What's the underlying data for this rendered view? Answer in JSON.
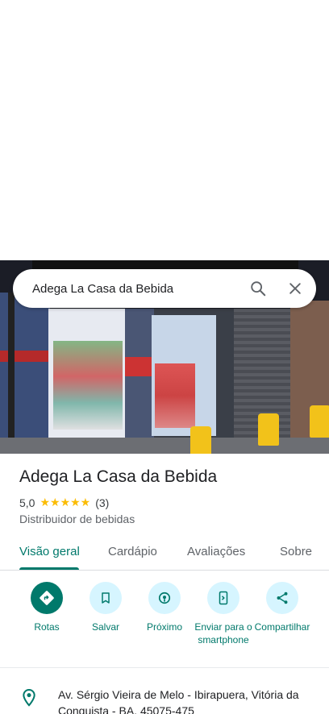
{
  "search": {
    "query": "Adega La Casa da Bebida"
  },
  "place": {
    "name": "Adega La Casa da Bebida",
    "rating": "5,0",
    "stars": "★★★★★",
    "reviews_count": "(3)",
    "category": "Distribuidor de bebidas",
    "address": "Av. Sérgio Vieira de Melo - Ibirapuera, Vitória da Conquista - BA, 45075-475"
  },
  "tabs": [
    {
      "label": "Visão geral",
      "active": true
    },
    {
      "label": "Cardápio"
    },
    {
      "label": "Avaliações"
    },
    {
      "label": "Sobre"
    }
  ],
  "actions": [
    {
      "label": "Rotas",
      "icon": "directions-icon"
    },
    {
      "label": "Salvar",
      "icon": "bookmark-icon"
    },
    {
      "label": "Próximo",
      "icon": "nearby-icon"
    },
    {
      "label": "Enviar para o smartphone",
      "icon": "send-to-phone-icon"
    },
    {
      "label": "Compartilhar",
      "icon": "share-icon"
    }
  ],
  "colors": {
    "accent": "#00796b",
    "action_bg": "#d6f5ff",
    "star": "#fbbc04"
  }
}
